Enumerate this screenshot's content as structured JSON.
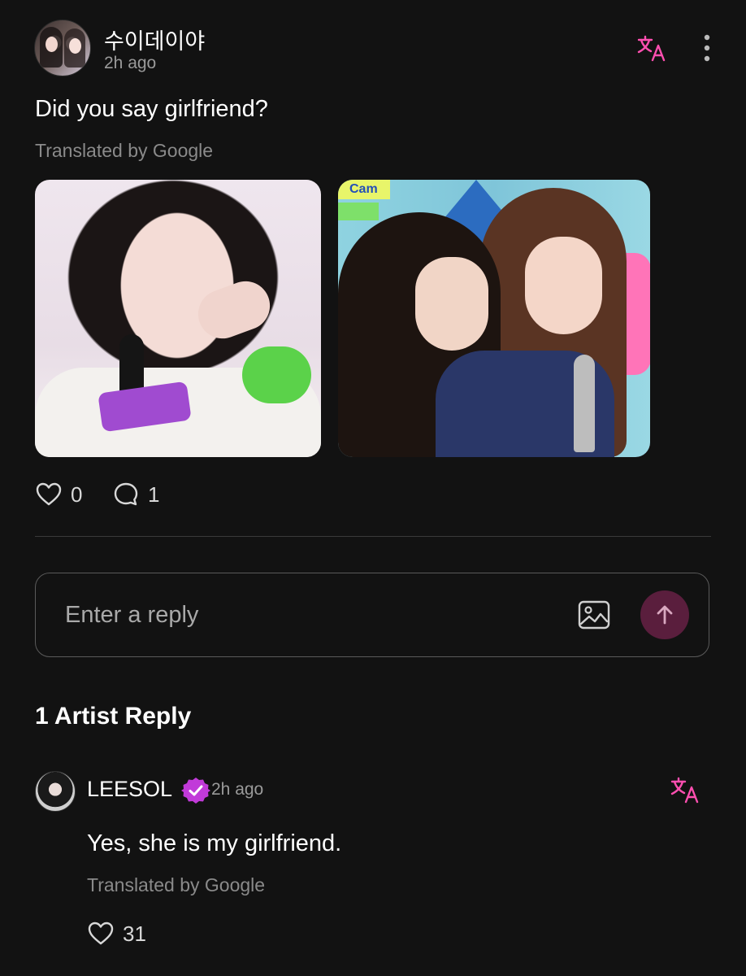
{
  "post": {
    "username": "수이데이야",
    "time": "2h ago",
    "text": "Did you say girlfriend?",
    "translated_by": "Translated by Google",
    "likes": "0",
    "comments": "1"
  },
  "reply_box": {
    "placeholder": "Enter a reply"
  },
  "artist_section": {
    "title": "1 Artist Reply"
  },
  "artist_reply": {
    "name": "LEESOL",
    "time": "2h ago",
    "text": "Yes, she is my girlfriend.",
    "translated_by": "Translated by Google",
    "likes": "31"
  },
  "photo_overlay": {
    "badge": "Cam"
  },
  "colors": {
    "background": "#121212",
    "accent": "#ff4fb0",
    "send_button": "#5a1e3d",
    "verified": "#c13ad9"
  },
  "icons": [
    "translate-icon",
    "more-vertical-icon",
    "heart-icon",
    "comment-icon",
    "image-icon",
    "arrow-up-icon",
    "verified-badge-icon"
  ]
}
